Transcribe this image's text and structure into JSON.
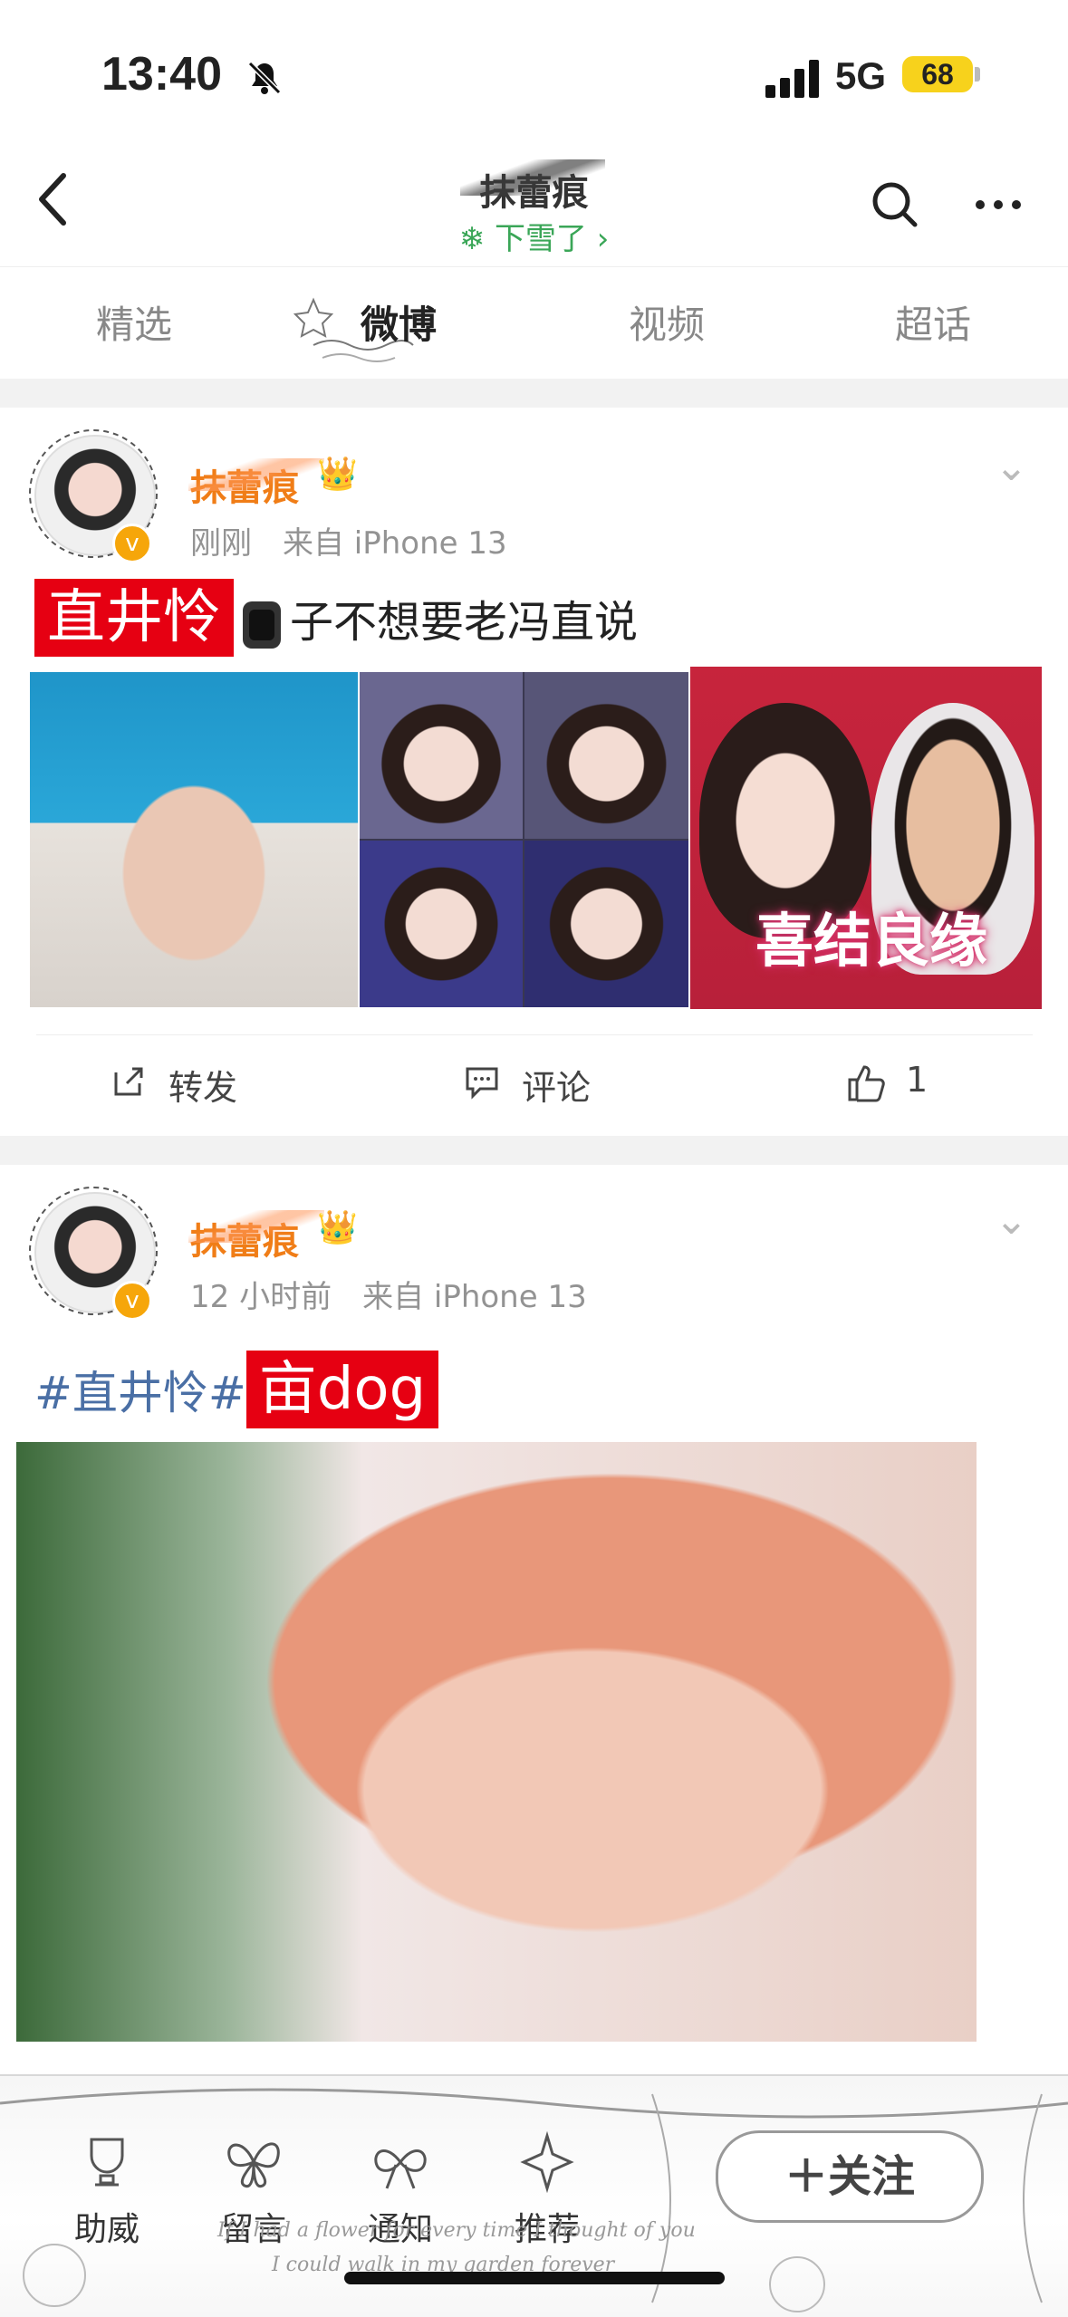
{
  "status_bar": {
    "time": "13:40",
    "network": "5G",
    "battery": "68"
  },
  "nav": {
    "title": "抹蕾痕",
    "weather": "下雪了 ›",
    "weather_icon": "snowflake-icon"
  },
  "tabs": [
    {
      "label": "精选"
    },
    {
      "label": "微博"
    },
    {
      "label": "视频"
    },
    {
      "label": "超话"
    }
  ],
  "posts": [
    {
      "username": "抹蕾痕",
      "time": "刚刚",
      "source": "来自 iPhone 13",
      "tag": "直井怜",
      "text": "子不想要老冯直说",
      "image_caption": "喜结良缘",
      "actions": {
        "repost": "转发",
        "comment": "评论",
        "like": "1"
      }
    },
    {
      "username": "抹蕾痕",
      "time": "12 小时前",
      "source": "来自 iPhone 13",
      "hashtag": "#直井怜#",
      "tag": "亩dog"
    }
  ],
  "bottom_bar": {
    "items": [
      {
        "label": "助威"
      },
      {
        "label": "留言"
      },
      {
        "label": "通知"
      },
      {
        "label": "推荐"
      }
    ],
    "follow": "＋关注",
    "script_line_1": "If I had a flower for every time I thought of you",
    "script_line_2": "I could walk in my garden forever"
  }
}
